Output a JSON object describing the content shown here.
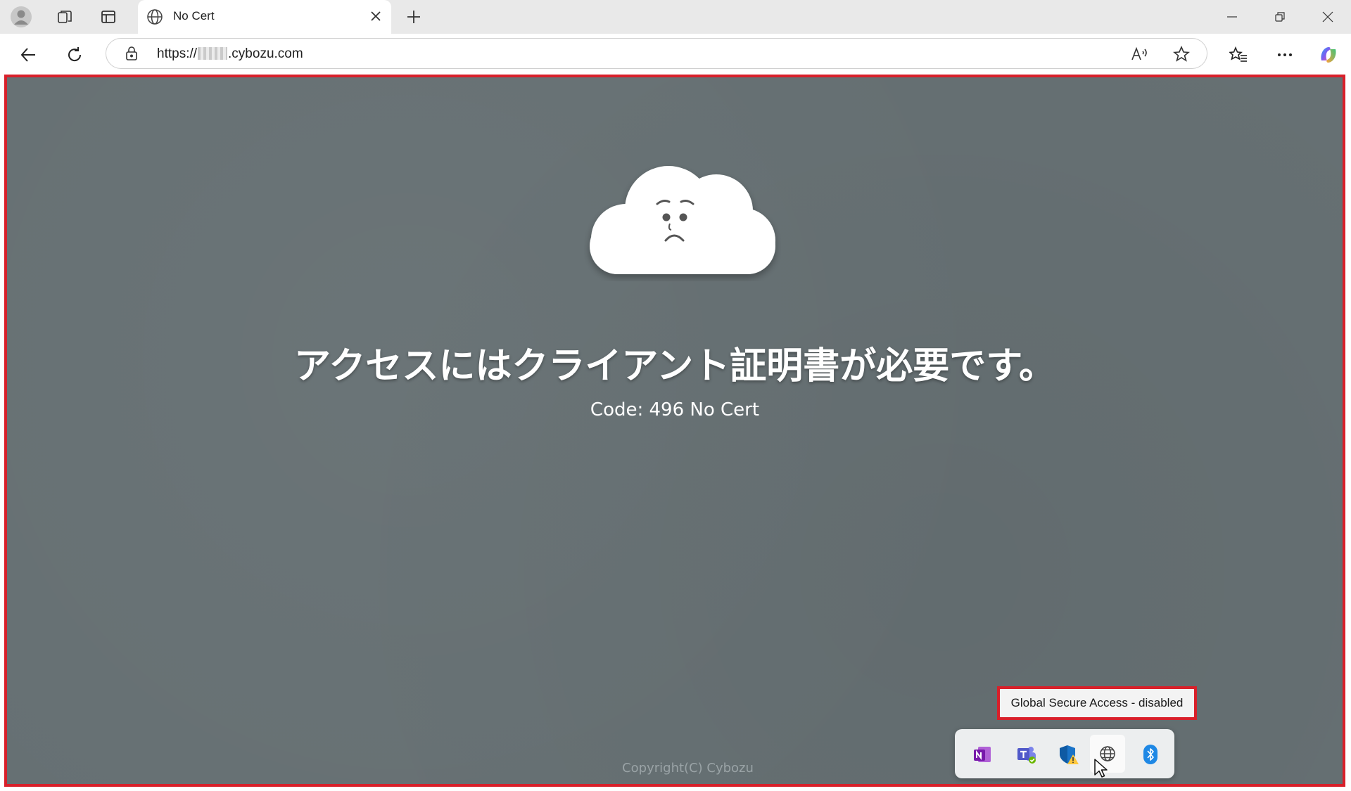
{
  "browser": {
    "tab": {
      "title": "No Cert"
    },
    "address": {
      "url_prefix": "https://",
      "url_suffix": ".cybozu.com"
    }
  },
  "page": {
    "headline": "アクセスにはクライアント証明書が必要です。",
    "code": "Code: 496 No Cert",
    "copyright": "Copyright(C) Cybozu"
  },
  "tray": {
    "tooltip": "Global Secure Access - disabled",
    "icons": [
      "onenote-icon",
      "teams-icon",
      "defender-warning-icon",
      "global-secure-access-icon",
      "bluetooth-icon"
    ]
  },
  "colors": {
    "page_background": "#667073",
    "highlight_border": "#d8202a",
    "tab_bar": "#e9e9e9"
  }
}
